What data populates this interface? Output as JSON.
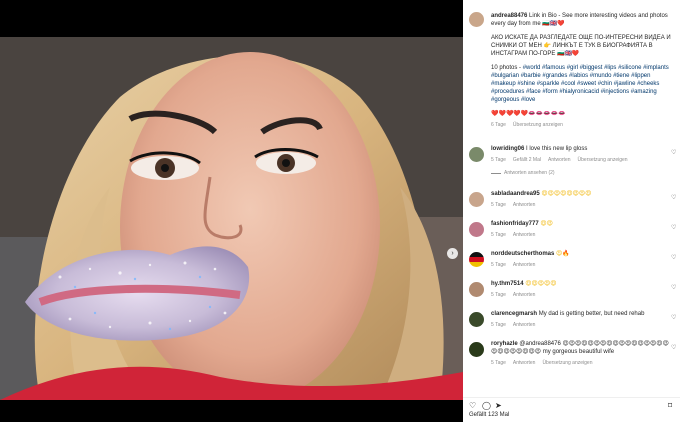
{
  "post": {
    "author": "andrea88476",
    "caption_intro": "Link in Bio - See more interesting videos and photos every day from me 🇧🇬🇬🇧❤️",
    "caption_bg": "АКО ИСКАТЕ ДА РАЗГЛЕДАТЕ ОЩЕ ПО-ИНТЕРЕСНИ ВИДЕА И СНИМКИ ОТ МЕН 👉 ЛИНКЪТ Е ТУК В БИОГРАФИЯТА В ИНСТАГРАМ ПО-ГОРЕ 🇧🇬🇬🇧❤️",
    "caption_prefix": "10 photos - ",
    "hashtags": "#world #famous #girl #biggest #lips #silicone #implants #bulgarian #barbie #grandes #labios #mundo #tiene #lippen #makeup #shine #sparkle #cool #sweet #chin #jawline #cheeks #procedures #face #form #hialyronicacid #injections #amazing #gorgeous #love",
    "caption_emojis": "❤️❤️❤️❤️❤️👄👄👄👄👄",
    "caption_time": "6 Tage",
    "caption_translate": "Übersetzung anzeigen"
  },
  "comments": [
    {
      "user": "lowriding06",
      "text": "I love this new lip gloss",
      "time": "5 Tage",
      "likes": "Gefällt 2 Mal",
      "reply": "Antworten",
      "translate": "Übersetzung anzeigen",
      "replies_label": "Antworten ansehen (2)",
      "avatar_color": "#7a8a6a"
    },
    {
      "user": "sabladaandrea95",
      "text": "😍😍😍😍😍😍😍😍",
      "time": "5 Tage",
      "reply": "Antworten",
      "avatar_color": "#c8a58c"
    },
    {
      "user": "fashionfriday777",
      "text": "😍😍",
      "time": "5 Tage",
      "reply": "Antworten",
      "avatar_color": "#c0788a"
    },
    {
      "user": "norddeutscherthomas",
      "text": "😍🔥",
      "time": "5 Tage",
      "reply": "Antworten",
      "avatar_color": "#d04020"
    },
    {
      "user": "hy.thm7514",
      "text": "😍😍😍😍😍",
      "time": "5 Tage",
      "reply": "Antworten",
      "avatar_color": "#b08a70"
    },
    {
      "user": "clarencegmarsh",
      "text": "My dad is getting better, but need rehab",
      "time": "5 Tage",
      "reply": "Antworten",
      "avatar_color": "#3a4a2a"
    },
    {
      "user": "roryhazle",
      "text": "@andrea88476 😍😍😍😍😍😍😍😍😍😍😍😍😍😍😍😍😍😍😍😍😍😍😍😍😍 my gorgeous beautiful wife",
      "time": "5 Tage",
      "reply": "Antworten",
      "translate": "Übersetzung anzeigen",
      "avatar_color": "#2a3a1a"
    }
  ],
  "footer": {
    "likes": "Gefällt 123 Mal"
  },
  "icons": {
    "heart": "heart-icon",
    "comment": "comment-icon",
    "share": "share-icon",
    "save": "bookmark-icon",
    "next": "chevron-right-icon"
  }
}
